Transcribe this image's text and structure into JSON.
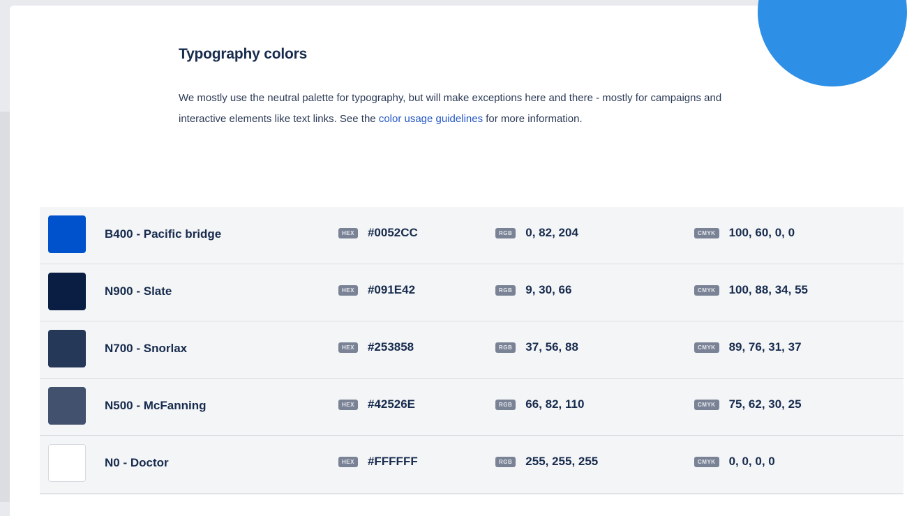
{
  "colors": {
    "accent_circle": "#2d8fe6",
    "link": "#2457c5"
  },
  "section": {
    "title": "Typography colors",
    "intro_before_link": "We mostly use the neutral palette for typography, but will make exceptions here and there - mostly for campaigns and interactive elements like text links. See the ",
    "link_text": "color usage guidelines",
    "intro_after_link": " for more information."
  },
  "badges": {
    "hex": "HEX",
    "rgb": "RGB",
    "cmyk": "CMYK"
  },
  "palette": [
    {
      "name": "B400 - Pacific bridge",
      "hex": "#0052CC",
      "rgb": "0, 82, 204",
      "cmyk": "100, 60, 0, 0",
      "swatch": "#0052CC"
    },
    {
      "name": "N900 - Slate",
      "hex": "#091E42",
      "rgb": "9, 30, 66",
      "cmyk": "100, 88, 34, 55",
      "swatch": "#091E42"
    },
    {
      "name": "N700 - Snorlax",
      "hex": "#253858",
      "rgb": "37, 56, 88",
      "cmyk": "89, 76, 31, 37",
      "swatch": "#253858"
    },
    {
      "name": "N500 - McFanning",
      "hex": "#42526E",
      "rgb": "66, 82, 110",
      "cmyk": "75, 62, 30, 25",
      "swatch": "#42526E"
    },
    {
      "name": "N0 - Doctor",
      "hex": "#FFFFFF",
      "rgb": "255, 255, 255",
      "cmyk": "0, 0, 0, 0",
      "swatch": "#FFFFFF"
    }
  ]
}
